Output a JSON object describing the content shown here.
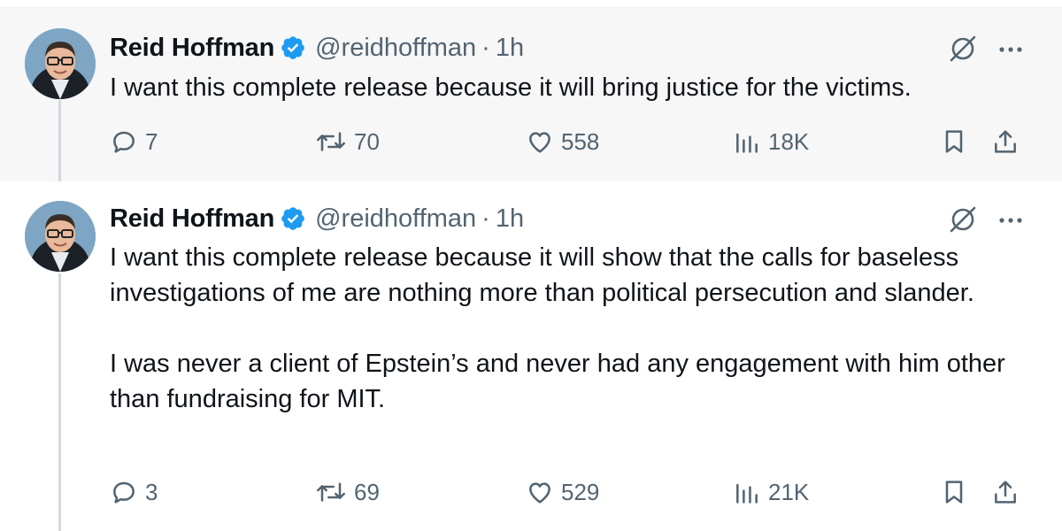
{
  "colors": {
    "verified_badge": "#1d9bf0",
    "secondary_text": "#536471",
    "primary_text": "#0f1419",
    "thread_line": "#cfd9de",
    "highlight_bg": "#f7f7f7"
  },
  "tweets": [
    {
      "author": {
        "name": "Reid Hoffman",
        "handle": "@reidhoffman",
        "verified": true,
        "avatar": "avatar-photo"
      },
      "separator": "·",
      "time": "1h",
      "text": "I want this complete release because it will bring justice for the victims.",
      "stats": {
        "replies": "7",
        "reposts": "70",
        "likes": "558",
        "views": "18K"
      },
      "icons": [
        "grok-icon",
        "more-icon",
        "reply-icon",
        "repost-icon",
        "like-icon",
        "views-icon",
        "bookmark-icon",
        "share-icon"
      ]
    },
    {
      "author": {
        "name": "Reid Hoffman",
        "handle": "@reidhoffman",
        "verified": true,
        "avatar": "avatar-photo"
      },
      "separator": "·",
      "time": "1h",
      "text": "I want this complete release because it will show that the calls for baseless investigations of me are nothing more than political persecution and slander.\n\nI was never a client of Epstein’s and never had any engagement with him other than fundraising for MIT.",
      "stats": {
        "replies": "3",
        "reposts": "69",
        "likes": "529",
        "views": "21K"
      },
      "icons": [
        "grok-icon",
        "more-icon",
        "reply-icon",
        "repost-icon",
        "like-icon",
        "views-icon",
        "bookmark-icon",
        "share-icon"
      ]
    }
  ]
}
